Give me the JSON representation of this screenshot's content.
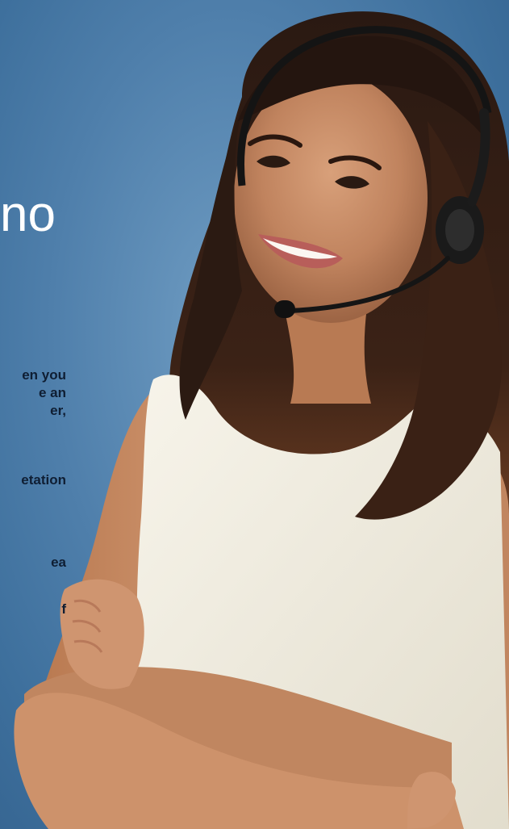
{
  "overlay": {
    "headline": "no",
    "body_lines": [
      "en you",
      "e an",
      "er,",
      "etation",
      "ea",
      "f"
    ]
  },
  "colors": {
    "background": "#4f7fab",
    "headline_text": "#ffffff",
    "body_text": "#0f1e33"
  }
}
